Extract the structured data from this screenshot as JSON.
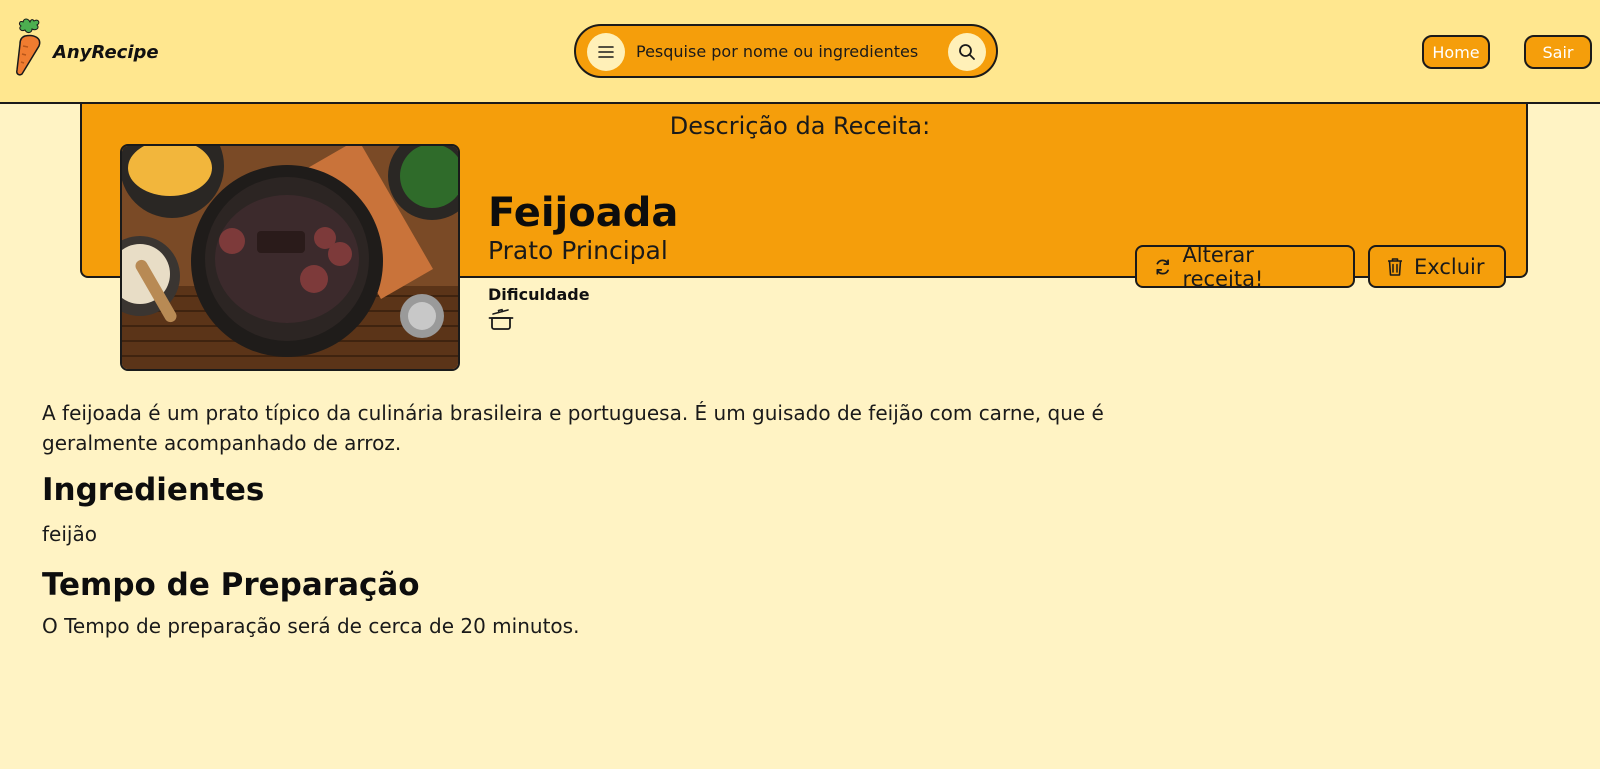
{
  "app": {
    "name": "AnyRecipe"
  },
  "header": {
    "search_placeholder": "Pesquise por nome ou ingredientes",
    "nav_home": "Home",
    "nav_exit": "Sair"
  },
  "recipe": {
    "section_title": "Descrição da Receita:",
    "name": "Feijoada",
    "category": "Prato Principal",
    "difficulty_label": "Dificuldade",
    "description": "A feijoada é um prato típico da culinária brasileira e portuguesa. É um guisado de feijão com carne, que é geralmente acompanhado de arroz.",
    "ingredients_title": "Ingredientes",
    "ingredients": "feijão",
    "time_title": "Tempo de Preparação",
    "time_text": "O Tempo de preparação será de cerca de 20 minutos."
  },
  "actions": {
    "alter_label": "Alterar receita!",
    "delete_label": "Excluir"
  },
  "colors": {
    "header_bg": "#ffe78f",
    "accent": "#f59e0b",
    "page_bg": "#fff3c4",
    "border": "#1a1a1a"
  }
}
